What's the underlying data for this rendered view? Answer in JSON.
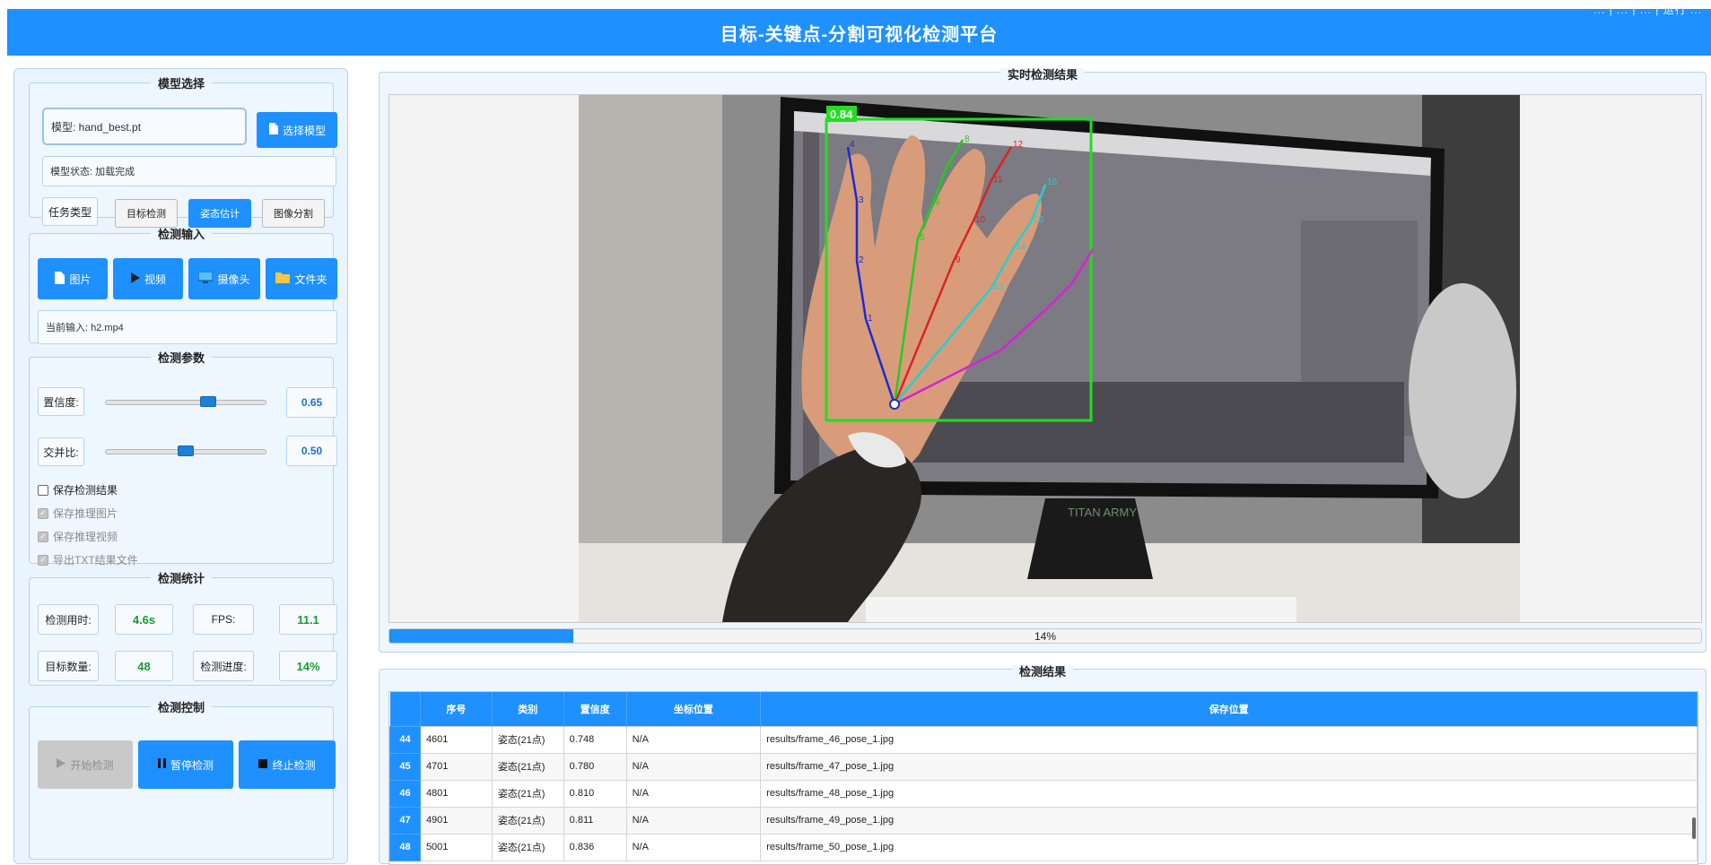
{
  "app": {
    "title": "目标-关键点-分割可视化检测平台",
    "system_status": "... | ... | ... | 运行 ..."
  },
  "model_select": {
    "legend": "模型选择",
    "model_field": "模型: hand_best.pt",
    "select_button": "选择模型",
    "status_field": "模型状态: 加载完成",
    "task_label": "任务类型",
    "task_buttons": [
      "目标检测",
      "姿态估计",
      "图像分割"
    ],
    "task_selected": "姿态估计"
  },
  "detect_input": {
    "legend": "检测输入",
    "buttons": [
      {
        "label": "图片",
        "icon": "file-icon"
      },
      {
        "label": "视频",
        "icon": "play-icon"
      },
      {
        "label": "摄像头",
        "icon": "monitor-icon"
      },
      {
        "label": "文件夹",
        "icon": "folder-icon"
      }
    ],
    "current_input": "当前输入: h2.mp4"
  },
  "detect_params": {
    "legend": "检测参数",
    "confidence_label": "置信度:",
    "confidence_value": "0.65",
    "confidence_level": 0.65,
    "iou_label": "交并比:",
    "iou_value": "0.50",
    "iou_level": 0.5,
    "save_results_label": "保存检测结果",
    "save_results_checked": false,
    "save_image_label": "保存推理图片",
    "save_video_label": "保存推理视频",
    "export_txt_label": "导出TXT结果文件"
  },
  "detect_stats": {
    "legend": "检测统计",
    "time_label": "检测用时:",
    "time_value": "4.6s",
    "fps_label": "FPS:",
    "fps_value": "11.1",
    "count_label": "目标数量:",
    "count_value": "48",
    "progress_label": "检测进度:",
    "progress_value": "14%"
  },
  "detect_control": {
    "legend": "检测控制",
    "start_label": "开始检测",
    "pause_label": "暂停检测",
    "stop_label": "终止检测"
  },
  "realtime": {
    "title": "实时检测结果",
    "box_confidence": "0.84",
    "keypoint_labels": [
      "1",
      "2",
      "3",
      "4",
      "5",
      "6",
      "7",
      "8",
      "9",
      "10",
      "11",
      "12",
      "13",
      "14",
      "15",
      "16"
    ],
    "screen_brand": "TITAN ARMY",
    "progress_text": "14%",
    "progress_level": 0.14
  },
  "results": {
    "title": "检测结果",
    "columns": [
      "序号",
      "类别",
      "置信度",
      "坐标位置",
      "保存位置"
    ],
    "rows": [
      {
        "n": "44",
        "id": "4601",
        "cls": "姿态(21点)",
        "conf": "0.748",
        "coord": "N/A",
        "path": "results/frame_46_pose_1.jpg"
      },
      {
        "n": "45",
        "id": "4701",
        "cls": "姿态(21点)",
        "conf": "0.780",
        "coord": "N/A",
        "path": "results/frame_47_pose_1.jpg"
      },
      {
        "n": "46",
        "id": "4801",
        "cls": "姿态(21点)",
        "conf": "0.810",
        "coord": "N/A",
        "path": "results/frame_48_pose_1.jpg"
      },
      {
        "n": "47",
        "id": "4901",
        "cls": "姿态(21点)",
        "conf": "0.811",
        "coord": "N/A",
        "path": "results/frame_49_pose_1.jpg"
      },
      {
        "n": "48",
        "id": "5001",
        "cls": "姿态(21点)",
        "conf": "0.836",
        "coord": "N/A",
        "path": "results/frame_50_pose_1.jpg"
      }
    ]
  }
}
